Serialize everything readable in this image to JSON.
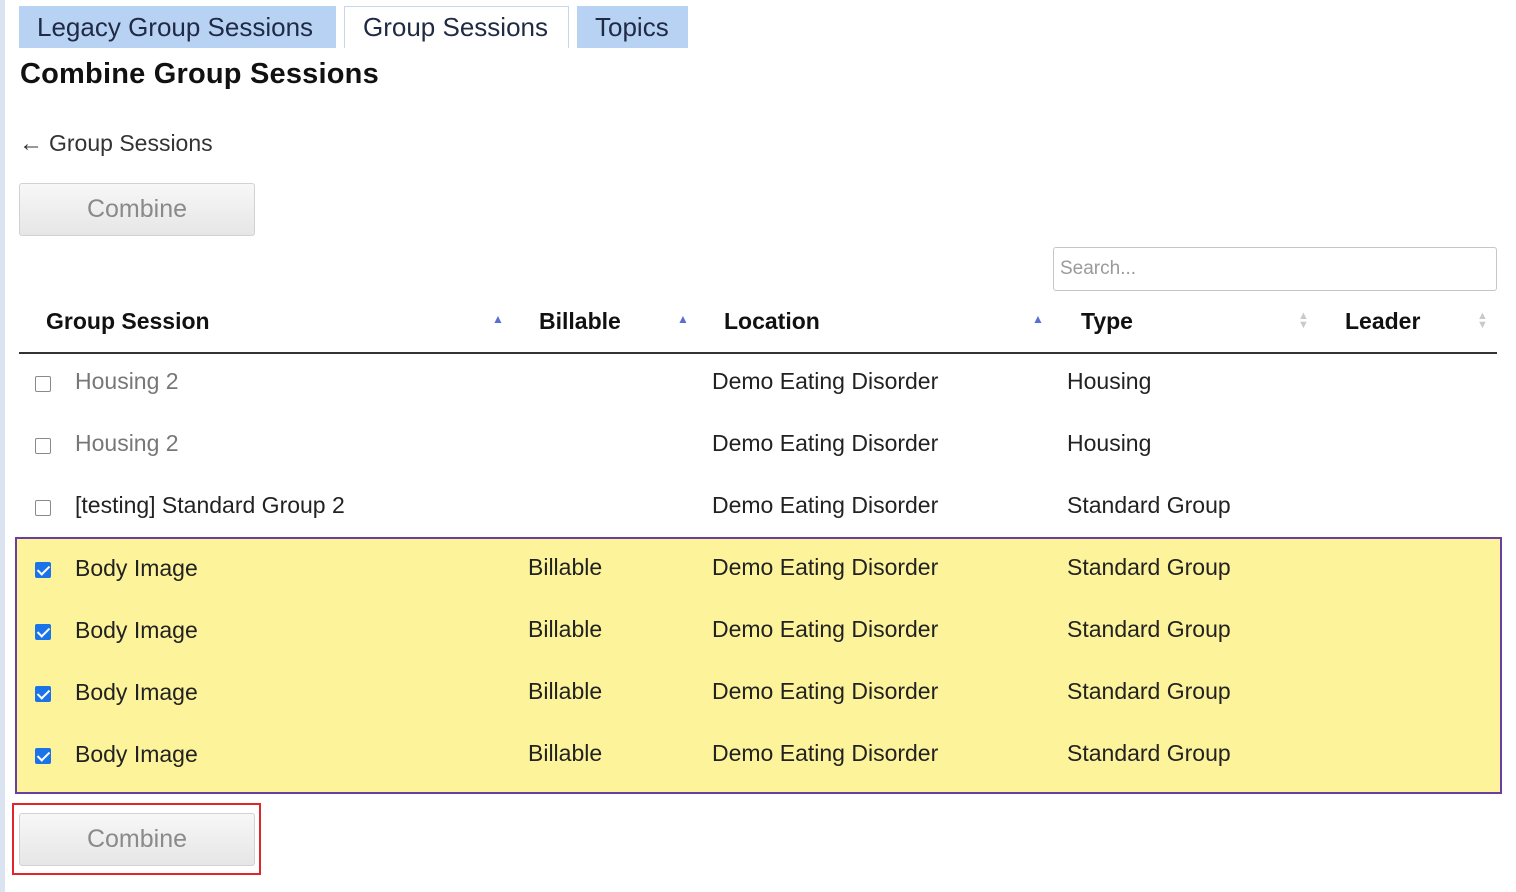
{
  "tabs": [
    {
      "label": "Legacy Group Sessions",
      "active": false
    },
    {
      "label": "Group Sessions",
      "active": true
    },
    {
      "label": "Topics",
      "active": false
    }
  ],
  "page_title": "Combine Group Sessions",
  "back_link": {
    "label": "Group Sessions"
  },
  "combine_label": "Combine",
  "search": {
    "placeholder": "Search..."
  },
  "table": {
    "columns": [
      {
        "label": "Group Session",
        "sort": "asc"
      },
      {
        "label": "Billable",
        "sort": "asc"
      },
      {
        "label": "Location",
        "sort": "asc"
      },
      {
        "label": "Type",
        "sort": "both"
      },
      {
        "label": "Leader",
        "sort": "both"
      }
    ],
    "rows": [
      {
        "checked": false,
        "session": "Housing 2",
        "billable": "",
        "location": "Demo Eating Disorder",
        "type": "Housing",
        "leader": ""
      },
      {
        "checked": false,
        "session": "Housing 2",
        "billable": "",
        "location": "Demo Eating Disorder",
        "type": "Housing",
        "leader": ""
      },
      {
        "checked": false,
        "session": "[testing] Standard Group 2",
        "billable": "",
        "location": "Demo Eating Disorder",
        "type": "Standard Group",
        "leader": ""
      },
      {
        "checked": true,
        "session": "Body Image",
        "billable": "Billable",
        "location": "Demo Eating Disorder",
        "type": "Standard Group",
        "leader": ""
      },
      {
        "checked": true,
        "session": "Body Image",
        "billable": "Billable",
        "location": "Demo Eating Disorder",
        "type": "Standard Group",
        "leader": ""
      },
      {
        "checked": true,
        "session": "Body Image",
        "billable": "Billable",
        "location": "Demo Eating Disorder",
        "type": "Standard Group",
        "leader": ""
      },
      {
        "checked": true,
        "session": "Body Image",
        "billable": "Billable",
        "location": "Demo Eating Disorder",
        "type": "Standard Group",
        "leader": ""
      }
    ]
  },
  "colors": {
    "selected_row_bg": "#fdf39a",
    "selection_outline": "#6b3fa0",
    "callout_outline": "#e0262a",
    "tab_bg": "#b7d2f3",
    "checkbox_checked": "#1a73e8"
  }
}
